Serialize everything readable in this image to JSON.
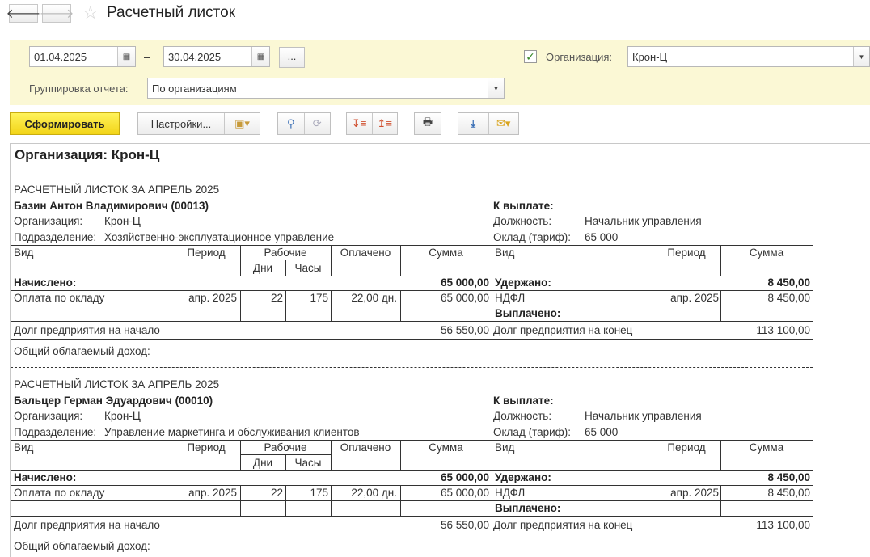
{
  "window": {
    "title": "Расчетный листок"
  },
  "filters": {
    "date_from": "01.04.2025",
    "date_to": "30.04.2025",
    "dash": "–",
    "dots": "...",
    "org_label": "Организация:",
    "org_value": "Крон-Ц",
    "org_checked": true,
    "group_label": "Группировка отчета:",
    "group_value": "По организациям"
  },
  "toolbar": {
    "generate": "Сформировать",
    "settings": "Настройки..."
  },
  "report": {
    "org_header": "Организация: Крон-Ц",
    "sheets": [
      {
        "title": "РАСЧЕТНЫЙ ЛИСТОК ЗА АПРЕЛЬ 2025",
        "employee": "Базин Антон Владимирович (00013)",
        "org_label": "Организация:",
        "org_value": "Крон-Ц",
        "dept_label": "Подразделение:",
        "dept_value": "Хозяйственно-эксплуатационное управление",
        "to_pay_label": "К выплате:",
        "position_label": "Должность:",
        "position_value": "Начальник управления",
        "salary_label": "Оклад (тариф):",
        "salary_value": "65 000",
        "headers": {
          "vid": "Вид",
          "period": "Период",
          "work": "Рабочие",
          "days": "Дни",
          "hours": "Часы",
          "paid": "Оплачено",
          "sum": "Сумма",
          "vid2": "Вид",
          "period2": "Период",
          "sum2": "Сумма"
        },
        "accrued_label": "Начислено:",
        "accrued_total": "65 000,00",
        "withheld_label": "Удержано:",
        "withheld_total": "8 450,00",
        "line": {
          "vid": "Оплата по окладу",
          "period": "апр. 2025",
          "days": "22",
          "hours": "175",
          "paid": "22,00 дн.",
          "sum": "65 000,00"
        },
        "wline": {
          "vid": "НДФЛ",
          "period": "апр. 2025",
          "sum": "8 450,00"
        },
        "paid_out_label": "Выплачено:",
        "debt_start_label": "Долг предприятия на начало",
        "debt_start": "56 550,00",
        "debt_end_label": "Долг предприятия на конец",
        "debt_end": "113 100,00",
        "taxable_label": "Общий облагаемый доход:"
      },
      {
        "title": "РАСЧЕТНЫЙ ЛИСТОК ЗА АПРЕЛЬ 2025",
        "employee": "Бальцер Герман Эдуардович (00010)",
        "org_label": "Организация:",
        "org_value": "Крон-Ц",
        "dept_label": "Подразделение:",
        "dept_value": "Управление маркетинга и обслуживания клиентов",
        "to_pay_label": "К выплате:",
        "position_label": "Должность:",
        "position_value": "Начальник управления",
        "salary_label": "Оклад (тариф):",
        "salary_value": "65 000",
        "headers": {
          "vid": "Вид",
          "period": "Период",
          "work": "Рабочие",
          "days": "Дни",
          "hours": "Часы",
          "paid": "Оплачено",
          "sum": "Сумма",
          "vid2": "Вид",
          "period2": "Период",
          "sum2": "Сумма"
        },
        "accrued_label": "Начислено:",
        "accrued_total": "65 000,00",
        "withheld_label": "Удержано:",
        "withheld_total": "8 450,00",
        "line": {
          "vid": "Оплата по окладу",
          "period": "апр. 2025",
          "days": "22",
          "hours": "175",
          "paid": "22,00 дн.",
          "sum": "65 000,00"
        },
        "wline": {
          "vid": "НДФЛ",
          "period": "апр. 2025",
          "sum": "8 450,00"
        },
        "paid_out_label": "Выплачено:",
        "debt_start_label": "Долг предприятия на начало",
        "debt_start": "56 550,00",
        "debt_end_label": "Долг предприятия на конец",
        "debt_end": "113 100,00",
        "taxable_label": "Общий облагаемый доход:"
      }
    ]
  }
}
